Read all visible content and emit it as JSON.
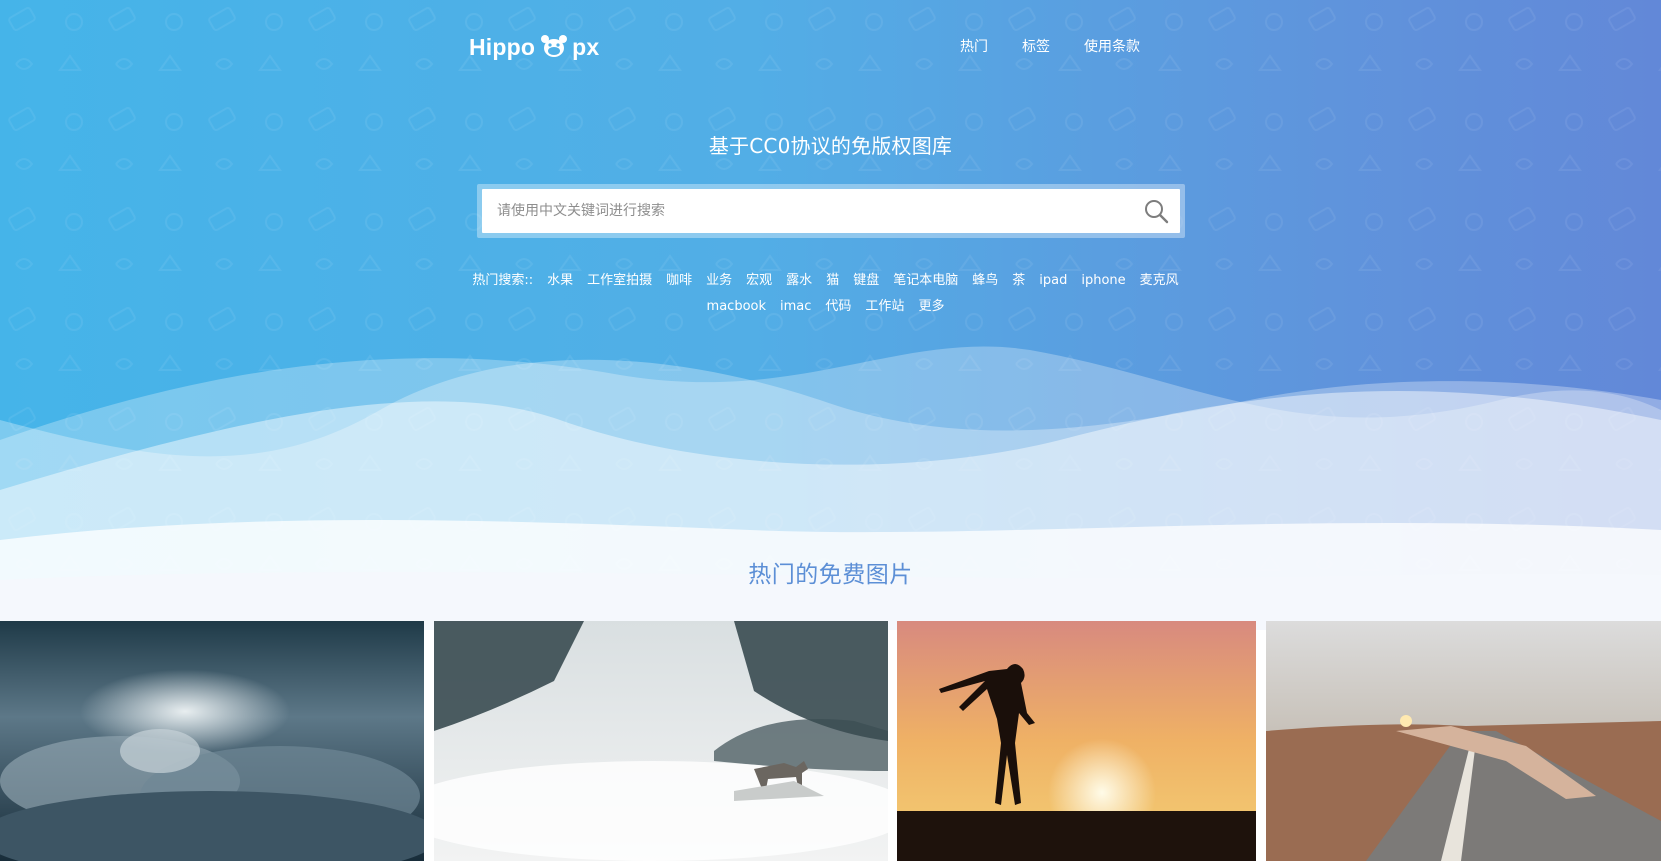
{
  "header": {
    "logo_left": "Hippo",
    "logo_right": "px",
    "nav": [
      {
        "label": "热门"
      },
      {
        "label": "标签"
      },
      {
        "label": "使用条款"
      }
    ]
  },
  "hero": {
    "title": "基于CC0协议的免版权图库"
  },
  "search": {
    "placeholder": "请使用中文关键词进行搜索",
    "value": "",
    "icon": "search-icon"
  },
  "hot_searches": {
    "label": "热门搜索::",
    "tags": [
      "水果",
      "工作室拍摄",
      "咖啡",
      "业务",
      "宏观",
      "露水",
      "猫",
      "键盘",
      "笔记本电脑",
      "蜂鸟",
      "茶",
      "ipad",
      "iphone",
      "麦克风",
      "macbook",
      "imac",
      "代码",
      "工作站",
      "更多"
    ]
  },
  "section": {
    "title": "热门的免费图片"
  },
  "gallery": {
    "photos": [
      {
        "subject": "stormy clouds with sunlight"
      },
      {
        "subject": "wolf on misty mountain"
      },
      {
        "subject": "woman silhouette at sunset"
      },
      {
        "subject": "swimmer on road"
      }
    ]
  },
  "colors": {
    "gradient_start": "#45b4e9",
    "gradient_end": "#6288d8",
    "section_title": "#5c8fd6",
    "text_light": "#ffffff"
  }
}
